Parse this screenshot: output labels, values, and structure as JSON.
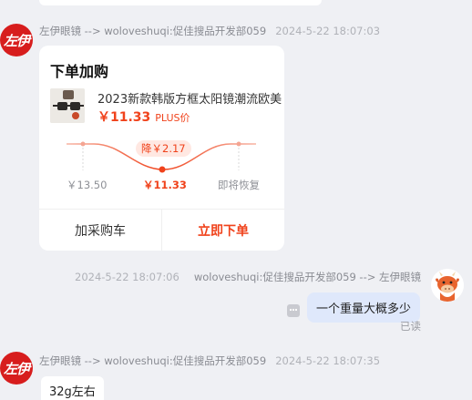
{
  "colors": {
    "background": "#eff0f4",
    "accent": "#f0421b",
    "brand_avatar": "#d71d1d",
    "outgoing_bubble": "#dfe8fb"
  },
  "avatar_brand": {
    "text": "左伊"
  },
  "message_1": {
    "sender_line": "左伊眼镜 --> woloveshuqi:促佳搜品开发部059",
    "time": "2024-5-22 18:07:03"
  },
  "order_card": {
    "title": "下单加购",
    "product_name": "2023新款韩版方框太阳镜潮流欧美",
    "price": "￥11.33",
    "price_tag": "PLUS价",
    "drop_badge": "降￥2.17",
    "chart_labels": {
      "before": "￥13.50",
      "now": "￥11.33",
      "after": "即将恢复"
    },
    "buttons": {
      "add_to_cart": "加采购车",
      "buy_now": "立即下单"
    }
  },
  "message_2": {
    "time": "2024-5-22 18:07:06",
    "sender_line": "woloveshuqi:促佳搜品开发部059 --> 左伊眼镜",
    "text": "一个重量大概多少",
    "status": "已读"
  },
  "message_3": {
    "sender_line": "左伊眼镜 --> woloveshuqi:促佳搜品开发部059",
    "time": "2024-5-22 18:07:35",
    "text": "32g左右"
  },
  "icons": {
    "brand_avatar": "brand-logo",
    "user_avatar": "cow-cartoon-avatar",
    "read_receipt": "message-status-icon"
  }
}
